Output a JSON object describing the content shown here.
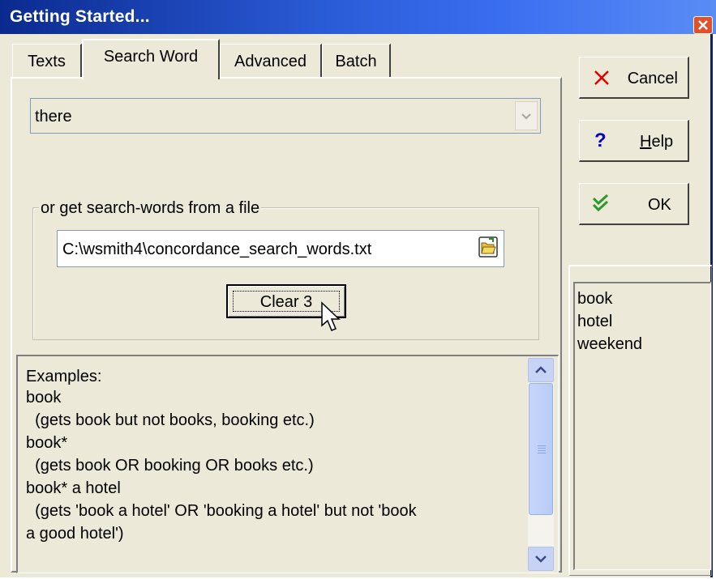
{
  "window": {
    "title": "Getting Started..."
  },
  "tabs": [
    {
      "label": "Texts",
      "active": false
    },
    {
      "label": "Search Word",
      "active": true
    },
    {
      "label": "Advanced",
      "active": false
    },
    {
      "label": "Batch",
      "active": false
    }
  ],
  "search": {
    "value": "there"
  },
  "file_group": {
    "legend": "or get search-words from a file",
    "path": "C:\\wsmith4\\concordance_search_words.txt",
    "clear_label": "Clear 3"
  },
  "examples": {
    "lines": [
      "Examples:",
      "book",
      "  (gets book but not books, booking etc.)",
      "book*",
      "  (gets book OR booking OR books etc.)",
      "book* a hotel",
      "  (gets 'book a hotel' OR 'booking a hotel' but not 'book",
      "a good hotel')"
    ]
  },
  "buttons": {
    "cancel": "Cancel",
    "help_prefix": "",
    "help_underlined": "H",
    "help_rest": "elp",
    "ok": "OK"
  },
  "word_list": [
    "book",
    "hotel",
    "weekend"
  ],
  "colors": {
    "titlebar": "#2a5bd6",
    "face": "#ece9d8",
    "cancel_x": "#e00000",
    "help_q": "#0000cc",
    "ok_check": "#2a9a2a"
  }
}
